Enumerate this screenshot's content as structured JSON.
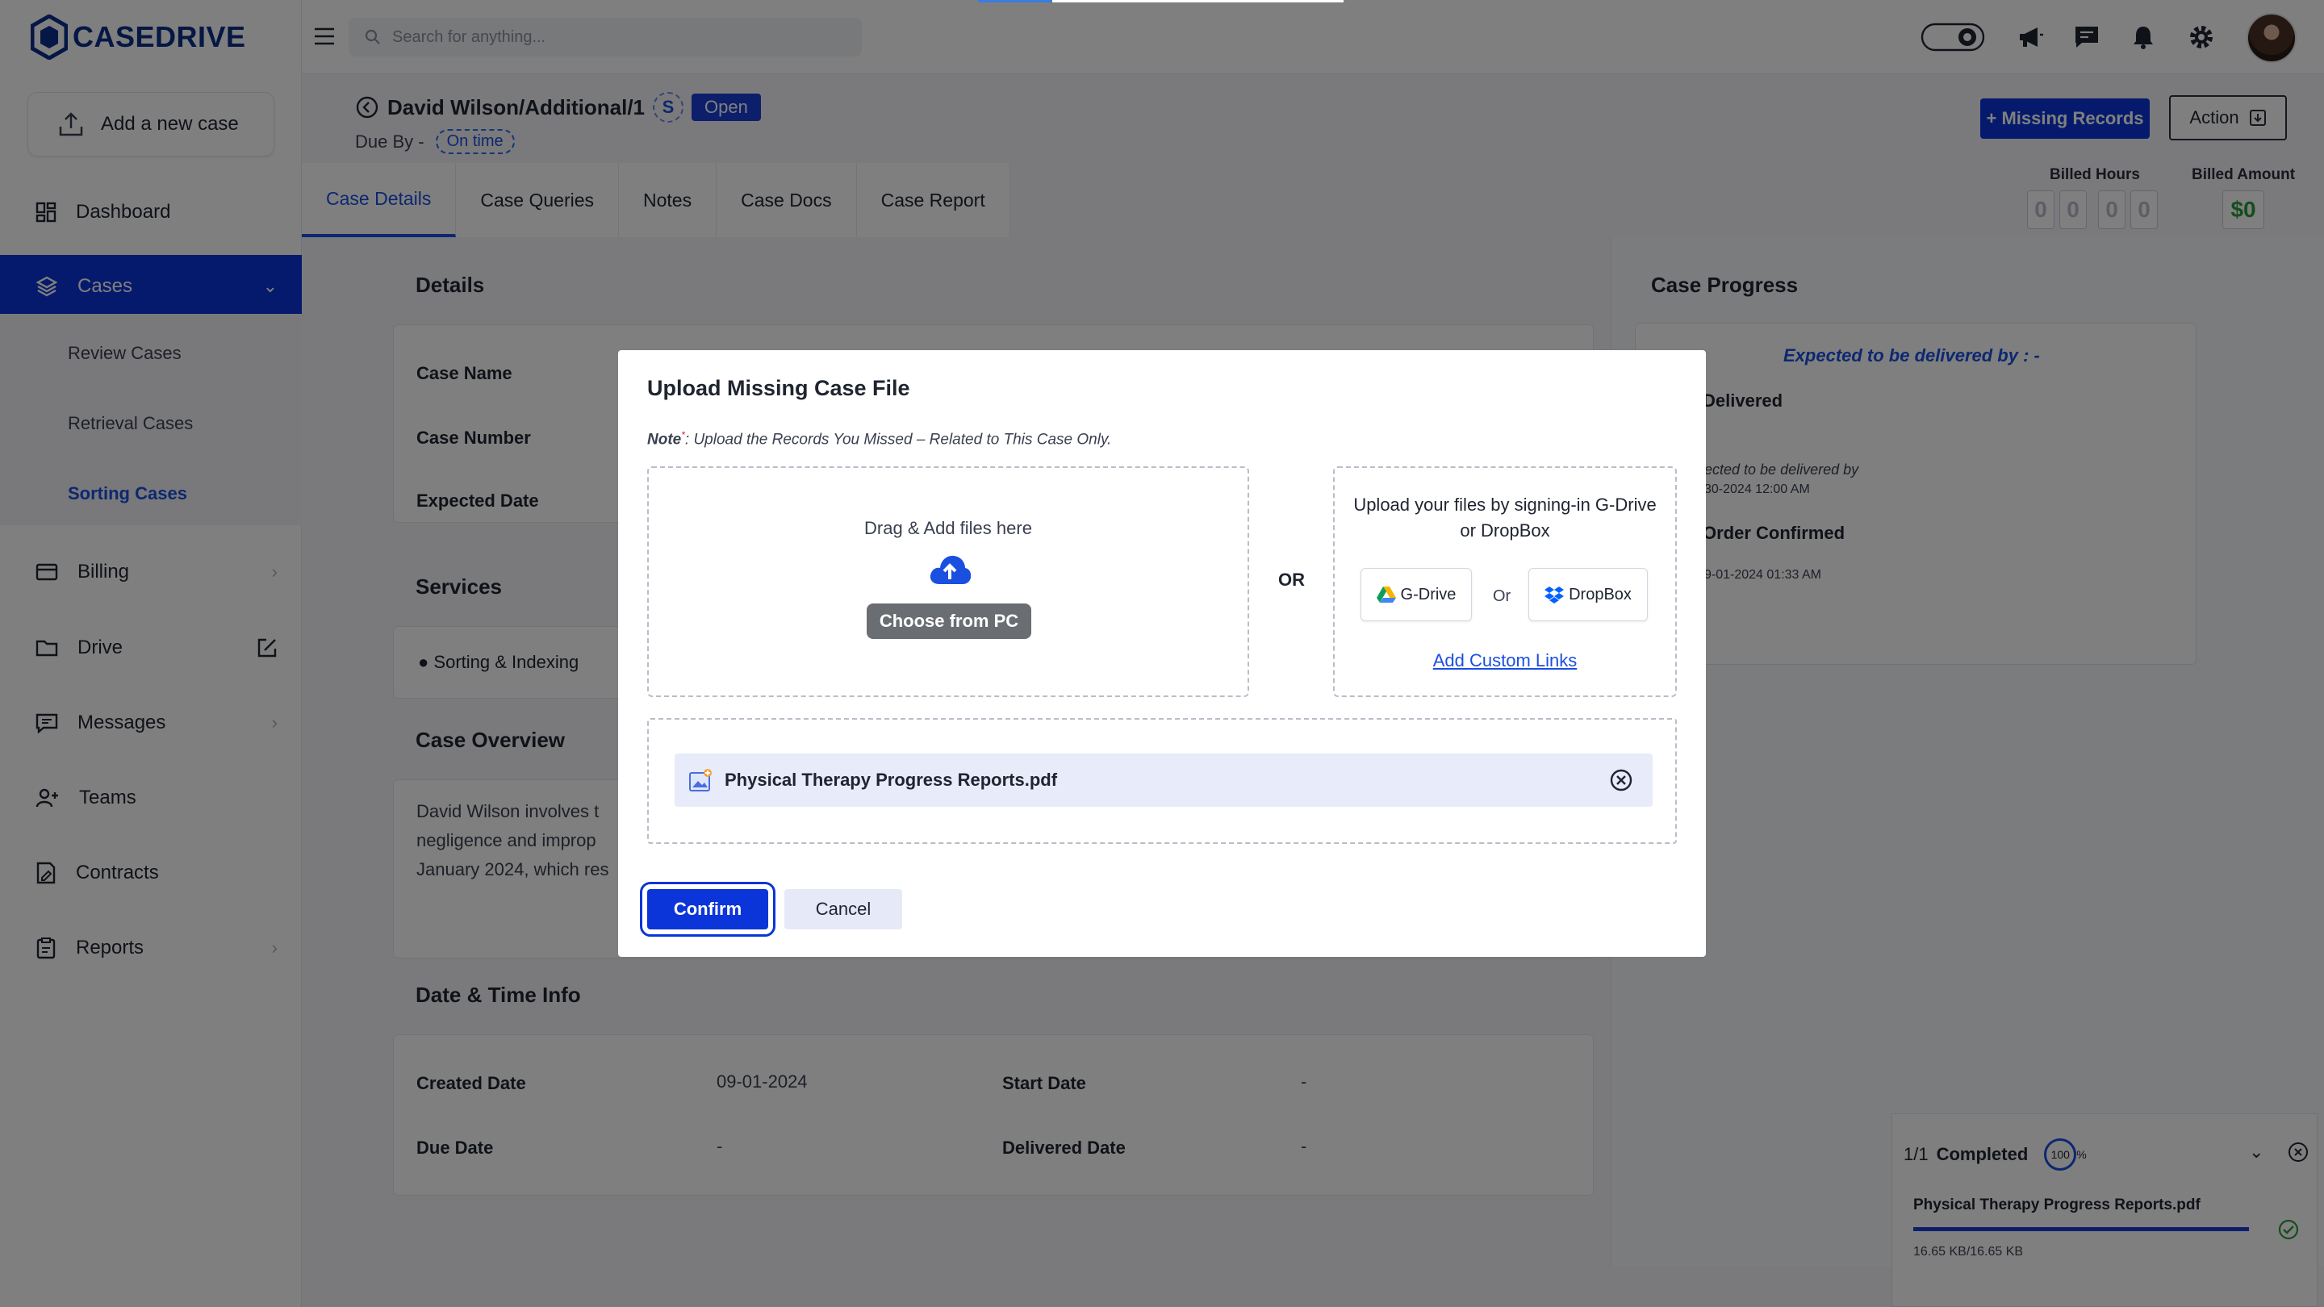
{
  "brand": {
    "name": "CASEDRIVE",
    "color": "#0b2e8a"
  },
  "colors": {
    "primary": "#0b35d8",
    "link": "#1a4fe0",
    "success": "#2a9a3a"
  },
  "sidebar": {
    "add_case_label": "Add a new case",
    "items": [
      {
        "label": "Dashboard",
        "icon": "grid-icon"
      },
      {
        "label": "Cases",
        "icon": "layers-icon",
        "active": true
      },
      {
        "label": "Billing",
        "icon": "card-icon"
      },
      {
        "label": "Drive",
        "icon": "folder-icon"
      },
      {
        "label": "Messages",
        "icon": "chat-icon"
      },
      {
        "label": "Teams",
        "icon": "users-icon"
      },
      {
        "label": "Contracts",
        "icon": "contract-icon"
      },
      {
        "label": "Reports",
        "icon": "clipboard-icon"
      }
    ],
    "sub_items": [
      {
        "label": "Review Cases"
      },
      {
        "label": "Retrieval Cases"
      },
      {
        "label": "Sorting Cases",
        "active": true
      }
    ]
  },
  "topbar": {
    "search_placeholder": "Search for anything..."
  },
  "case": {
    "title": "David Wilson/Additional/1",
    "s_badge": "S",
    "status": "Open",
    "due_by_label": "Due By -",
    "due_status": "On time",
    "missing_records_label": "+ Missing Records",
    "action_label": "Action"
  },
  "tabs": [
    "Case Details",
    "Case Queries",
    "Notes",
    "Case Docs",
    "Case Report"
  ],
  "billing": {
    "hours_label": "Billed Hours",
    "hours_digits": [
      "0",
      "0",
      "0",
      "0"
    ],
    "amount_label": "Billed Amount",
    "amount": "$0"
  },
  "details": {
    "title": "Details",
    "fields": [
      "Case Name",
      "Case Number",
      "Expected Date"
    ],
    "services_title": "Services",
    "service_item": "Sorting & Indexing",
    "overview_title": "Case Overview",
    "overview_lines": [
      "David Wilson involves t",
      "negligence and improp",
      "January 2024, which res"
    ],
    "datetime_title": "Date & Time Info",
    "created_label": "Created Date",
    "created_value": "09-01-2024",
    "start_label": "Start Date",
    "start_value": "-",
    "due_label": "Due Date",
    "due_value": "-",
    "delivered_label": "Delivered Date",
    "delivered_value": "-"
  },
  "progress": {
    "title": "Case Progress",
    "expected_heading": "Expected to be delivered by : -",
    "step1": "Delivered",
    "step2_line": "ected to be delivered by",
    "step2_date": "30-2024 12:00 AM",
    "step3": "Order Confirmed",
    "step3_date": "9-01-2024 01:33 AM"
  },
  "upload_panel": {
    "count": "1/1",
    "label": "Completed",
    "percent": "100",
    "percent_sign": "%",
    "file_name": "Physical Therapy Progress Reports.pdf",
    "size": "16.65 KB/16.65 KB",
    "progress": 1.0
  },
  "modal": {
    "title": "Upload Missing Case File",
    "note_label": "Note",
    "note_mark": "*",
    "note_text": ": Upload the Records You Missed – Related to This Case Only.",
    "drag_text": "Drag & Add files here",
    "choose_label": "Choose from PC",
    "or_label": "OR",
    "cloud_text": "Upload your files by signing-in G-Drive or DropBox",
    "gdrive_label": "G-Drive",
    "cloud_or": "Or",
    "dropbox_label": "DropBox",
    "custom_links_label": "Add Custom Links",
    "file_name": "Physical Therapy Progress Reports.pdf",
    "confirm_label": "Confirm",
    "cancel_label": "Cancel"
  }
}
